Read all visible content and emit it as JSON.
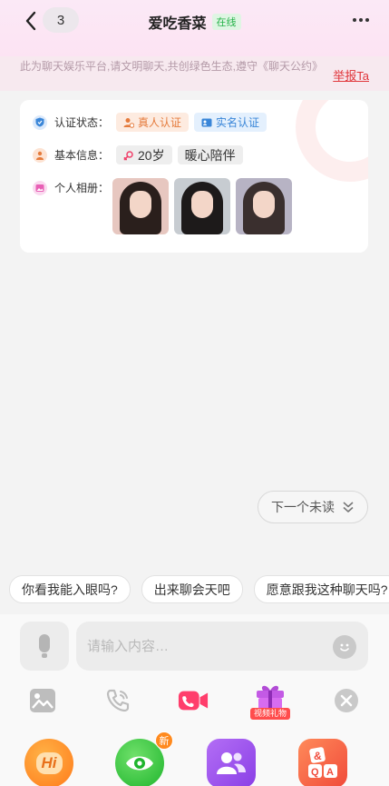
{
  "header": {
    "unread_count": "3",
    "title": "爱吃香菜",
    "status": "在线"
  },
  "notice": {
    "text": "此为聊天娱乐平台,请文明聊天,共创绿色生态,遵守《聊天公约》",
    "report_label": "举报Ta"
  },
  "profile": {
    "cert_label": "认证状态：",
    "cert_real": "真人认证",
    "cert_name": "实名认证",
    "basic_label": "基本信息：",
    "age": "20岁",
    "tag": "暖心陪伴",
    "album_label": "个人相册："
  },
  "next_unread_label": "下一个未读",
  "quick_replies": [
    "你看我能入眼吗?",
    "出来聊会天吧",
    "愿意跟我这种聊天吗?"
  ],
  "input": {
    "placeholder": "请输入内容…"
  },
  "tools": {
    "gift_label": "视频礼物"
  },
  "features": {
    "new_badge": "新",
    "hi_label": "Hi",
    "qa_label": "&"
  },
  "colors": {
    "header_bg": "#fce3f3",
    "report_red": "#e0353a",
    "online_green": "#27b34a",
    "real_orange": "#e57b3c",
    "name_blue": "#3a86d8"
  }
}
